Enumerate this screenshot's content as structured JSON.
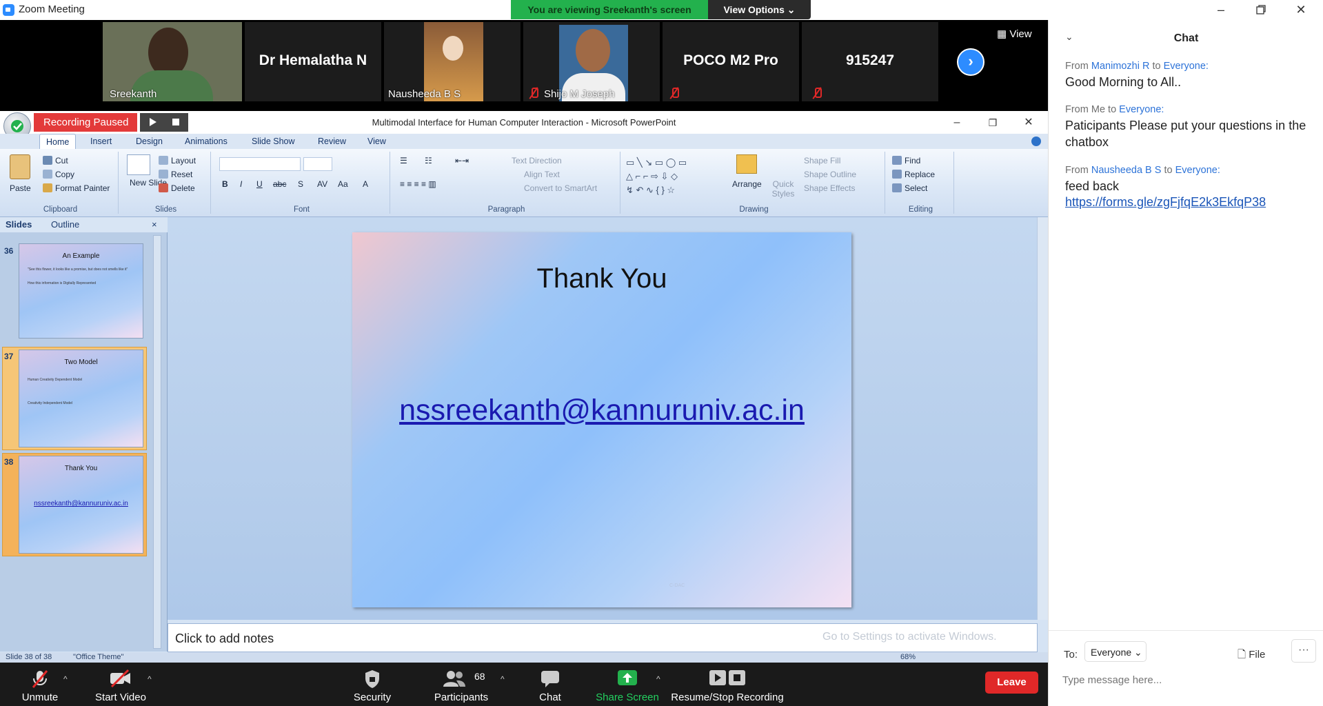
{
  "window": {
    "title": "Zoom Meeting"
  },
  "banner": {
    "viewing": "You are viewing Sreekanth's screen",
    "view_options": "View Options ⌄"
  },
  "participants": {
    "tiles": [
      {
        "name": "Sreekanth"
      },
      {
        "name": "Dr Hemalatha N"
      },
      {
        "name": "Nausheeda B S"
      },
      {
        "name": "Shijo M Joseph"
      },
      {
        "name": "POCO M2 Pro"
      },
      {
        "name": "915247"
      }
    ],
    "view_label": "View"
  },
  "powerpoint": {
    "title": "Multimodal Interface for Human Computer Interaction - Microsoft PowerPoint",
    "recording_status": "Recording Paused",
    "tabs": [
      "Home",
      "Insert",
      "Design",
      "Animations",
      "Slide Show",
      "Review",
      "View"
    ],
    "groups": {
      "clipboard": {
        "label": "Clipboard",
        "paste": "Paste",
        "cut": "Cut",
        "copy": "Copy",
        "format_painter": "Format Painter"
      },
      "slides": {
        "label": "Slides",
        "new_slide": "New Slide",
        "layout": "Layout",
        "reset": "Reset",
        "delete": "Delete"
      },
      "font": {
        "label": "Font"
      },
      "paragraph": {
        "label": "Paragraph",
        "text_direction": "Text Direction",
        "align_text": "Align Text",
        "convert_smartart": "Convert to SmartArt"
      },
      "drawing": {
        "label": "Drawing",
        "arrange": "Arrange",
        "quick_styles": "Quick Styles",
        "shape_fill": "Shape Fill",
        "shape_outline": "Shape Outline",
        "shape_effects": "Shape Effects"
      },
      "editing": {
        "label": "Editing",
        "find": "Find",
        "replace": "Replace",
        "select": "Select"
      }
    },
    "panel_tabs": {
      "slides": "Slides",
      "outline": "Outline"
    },
    "thumbnails": [
      {
        "num": "36",
        "title": "An Example",
        "bullets": [
          "\"See this flower, it looks like a promise, but does not smells like it\"",
          "How this information is Digitally Represented"
        ]
      },
      {
        "num": "37",
        "title": "Two Model",
        "bullets": [
          "Human Creativity Dependent Model",
          "Creativity Independent Model"
        ]
      },
      {
        "num": "38",
        "title": "Thank You",
        "link": "nssreekanth@kannuruniv.ac.in"
      }
    ],
    "current_slide": {
      "title": "Thank You",
      "link": "nssreekanth@kannuruniv.ac.in"
    },
    "notes_placeholder": "Click to add notes",
    "activate": "Go to Settings to activate Windows.",
    "status": {
      "slide": "Slide 38 of 38",
      "theme": "\"Office Theme\"",
      "zoom": "68%"
    }
  },
  "toolbar": {
    "unmute": "Unmute",
    "start_video": "Start Video",
    "security": "Security",
    "participants": "Participants",
    "participant_count": "68",
    "chat": "Chat",
    "share_screen": "Share Screen",
    "recording": "Resume/Stop Recording",
    "leave": "Leave"
  },
  "chat": {
    "header": "Chat",
    "messages": [
      {
        "from": "Manimozhi R",
        "to": "Everyone:",
        "text": "Good Morning to All.."
      },
      {
        "from": "Me",
        "to": "Everyone:",
        "text": "Paticipants Please put your questions in the chatbox"
      },
      {
        "from": "Nausheeda B S",
        "to": "Everyone:",
        "text": "feed back",
        "link": "https://forms.gle/zgFjfqE2k3EkfqP38"
      }
    ],
    "to_label": "To:",
    "recipient": "Everyone",
    "file_label": "File",
    "more": "···",
    "placeholder": "Type message here..."
  },
  "colors": {
    "zoom_blue": "#2d8cff",
    "leave_red": "#e02828",
    "recording_red": "#e33a3a",
    "share_green": "#23b14d"
  }
}
